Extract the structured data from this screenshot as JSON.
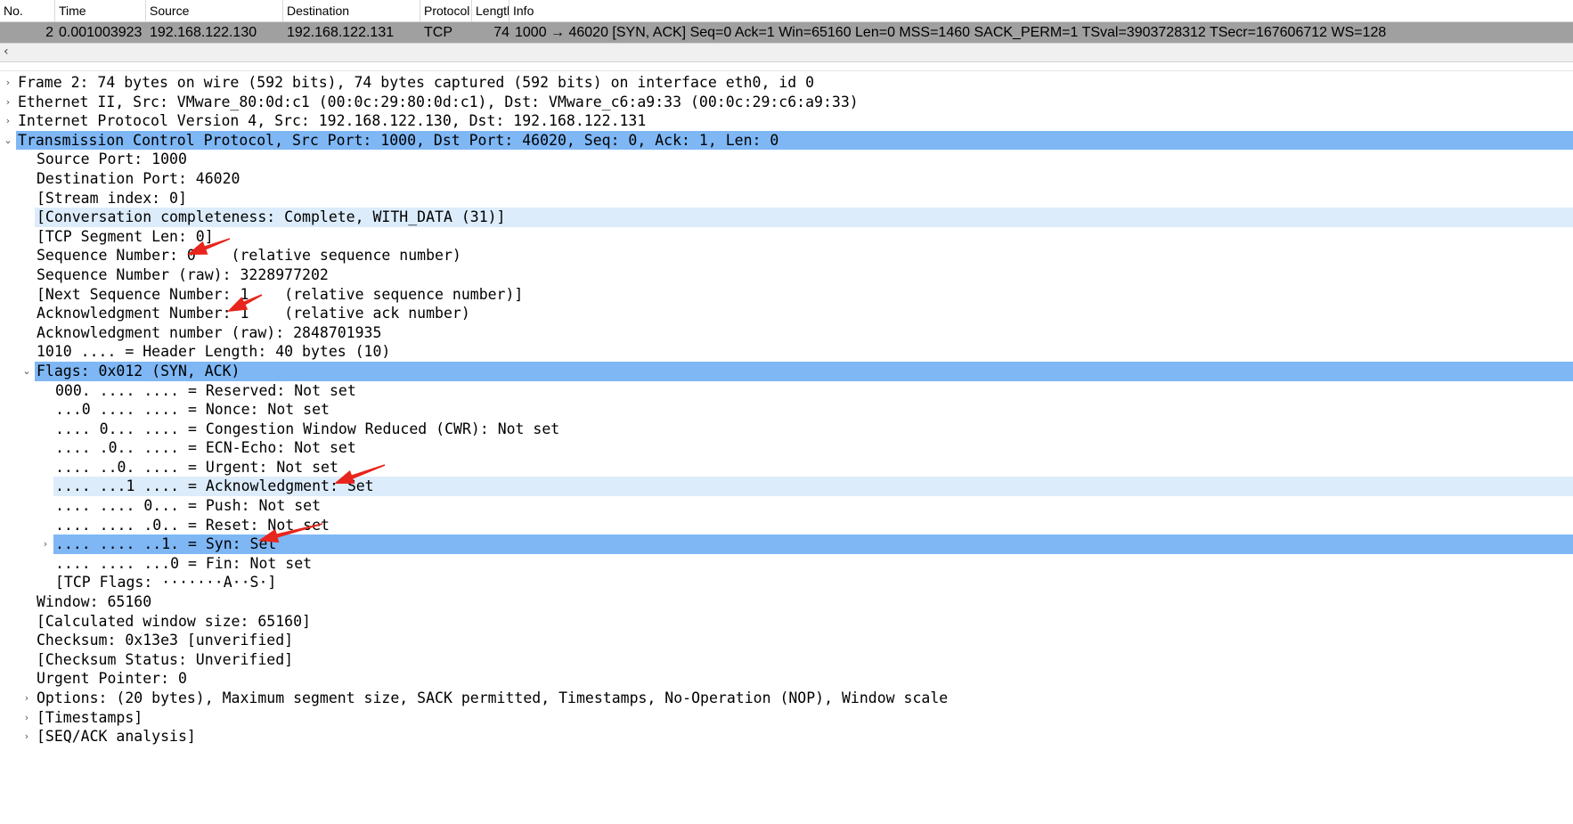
{
  "packet_list": {
    "columns": [
      "No.",
      "Time",
      "Source",
      "Destination",
      "Protocol",
      "Length",
      "Info"
    ],
    "row": {
      "no": "2",
      "time": "0.001003923",
      "source": "192.168.122.130",
      "destination": "192.168.122.131",
      "protocol": "TCP",
      "length": "74",
      "info": "1000 → 46020 [SYN, ACK] Seq=0 Ack=1 Win=65160 Len=0 MSS=1460 SACK_PERM=1 TSval=3903728312 TSecr=167606712 WS=128"
    },
    "scroll_left_icon": "chevron-left-icon"
  },
  "details": [
    {
      "text": "Frame 2: 74 bytes on wire (592 bits), 74 bytes captured (592 bits) on interface eth0, id 0",
      "level": 0,
      "toggle": "collapsed",
      "highlight": ""
    },
    {
      "text": "Ethernet II, Src: VMware_80:0d:c1 (00:0c:29:80:0d:c1), Dst: VMware_c6:a9:33 (00:0c:29:c6:a9:33)",
      "level": 0,
      "toggle": "collapsed",
      "highlight": ""
    },
    {
      "text": "Internet Protocol Version 4, Src: 192.168.122.130, Dst: 192.168.122.131",
      "level": 0,
      "toggle": "collapsed",
      "highlight": ""
    },
    {
      "text": "Transmission Control Protocol, Src Port: 1000, Dst Port: 46020, Seq: 0, Ack: 1, Len: 0",
      "level": 0,
      "toggle": "expanded",
      "highlight": "strong"
    },
    {
      "text": "Source Port: 1000",
      "level": 1,
      "toggle": "",
      "highlight": ""
    },
    {
      "text": "Destination Port: 46020",
      "level": 1,
      "toggle": "",
      "highlight": ""
    },
    {
      "text": "[Stream index: 0]",
      "level": 1,
      "toggle": "",
      "highlight": ""
    },
    {
      "text": "[Conversation completeness: Complete, WITH_DATA (31)]",
      "level": 1,
      "toggle": "",
      "highlight": "light"
    },
    {
      "text": "[TCP Segment Len: 0]",
      "level": 1,
      "toggle": "",
      "highlight": ""
    },
    {
      "text": "Sequence Number: 0    (relative sequence number)",
      "level": 1,
      "toggle": "",
      "highlight": ""
    },
    {
      "text": "Sequence Number (raw): 3228977202",
      "level": 1,
      "toggle": "",
      "highlight": ""
    },
    {
      "text": "[Next Sequence Number: 1    (relative sequence number)]",
      "level": 1,
      "toggle": "",
      "highlight": ""
    },
    {
      "text": "Acknowledgment Number: 1    (relative ack number)",
      "level": 1,
      "toggle": "",
      "highlight": ""
    },
    {
      "text": "Acknowledgment number (raw): 2848701935",
      "level": 1,
      "toggle": "",
      "highlight": ""
    },
    {
      "text": "1010 .... = Header Length: 40 bytes (10)",
      "level": 1,
      "toggle": "",
      "highlight": ""
    },
    {
      "text": "Flags: 0x012 (SYN, ACK)",
      "level": 1,
      "toggle": "expanded",
      "highlight": "strong"
    },
    {
      "text": "000. .... .... = Reserved: Not set",
      "level": 2,
      "toggle": "",
      "highlight": ""
    },
    {
      "text": "...0 .... .... = Nonce: Not set",
      "level": 2,
      "toggle": "",
      "highlight": ""
    },
    {
      "text": ".... 0... .... = Congestion Window Reduced (CWR): Not set",
      "level": 2,
      "toggle": "",
      "highlight": ""
    },
    {
      "text": ".... .0.. .... = ECN-Echo: Not set",
      "level": 2,
      "toggle": "",
      "highlight": ""
    },
    {
      "text": ".... ..0. .... = Urgent: Not set",
      "level": 2,
      "toggle": "",
      "highlight": ""
    },
    {
      "text": ".... ...1 .... = Acknowledgment: Set",
      "level": 2,
      "toggle": "",
      "highlight": "light"
    },
    {
      "text": ".... .... 0... = Push: Not set",
      "level": 2,
      "toggle": "",
      "highlight": ""
    },
    {
      "text": ".... .... .0.. = Reset: Not set",
      "level": 2,
      "toggle": "",
      "highlight": ""
    },
    {
      "text": ".... .... ..1. = Syn: Set",
      "level": 2,
      "toggle": "collapsed",
      "highlight": "strong"
    },
    {
      "text": ".... .... ...0 = Fin: Not set",
      "level": 2,
      "toggle": "",
      "highlight": ""
    },
    {
      "text": "[TCP Flags: ·······A··S·]",
      "level": 2,
      "toggle": "",
      "highlight": ""
    },
    {
      "text": "Window: 65160",
      "level": 1,
      "toggle": "",
      "highlight": ""
    },
    {
      "text": "[Calculated window size: 65160]",
      "level": 1,
      "toggle": "",
      "highlight": ""
    },
    {
      "text": "Checksum: 0x13e3 [unverified]",
      "level": 1,
      "toggle": "",
      "highlight": ""
    },
    {
      "text": "[Checksum Status: Unverified]",
      "level": 1,
      "toggle": "",
      "highlight": ""
    },
    {
      "text": "Urgent Pointer: 0",
      "level": 1,
      "toggle": "",
      "highlight": ""
    },
    {
      "text": "Options: (20 bytes), Maximum segment size, SACK permitted, Timestamps, No-Operation (NOP), Window scale",
      "level": 1,
      "toggle": "collapsed",
      "highlight": ""
    },
    {
      "text": "[Timestamps]",
      "level": 1,
      "toggle": "collapsed",
      "highlight": ""
    },
    {
      "text": "[SEQ/ACK analysis]",
      "level": 1,
      "toggle": "collapsed",
      "highlight": ""
    }
  ],
  "annotations": {
    "color": "#e8251c",
    "arrows": [
      {
        "points_to": "Sequence Number: 0"
      },
      {
        "points_to": "Acknowledgment Number: 1"
      },
      {
        "points_to": "Acknowledgment: Set"
      },
      {
        "points_to": "Syn: Set"
      }
    ]
  },
  "colors": {
    "selected_strong": "#7fb7f5",
    "selected_light": "#dcecfb",
    "packet_row": "#a0a0a0"
  }
}
